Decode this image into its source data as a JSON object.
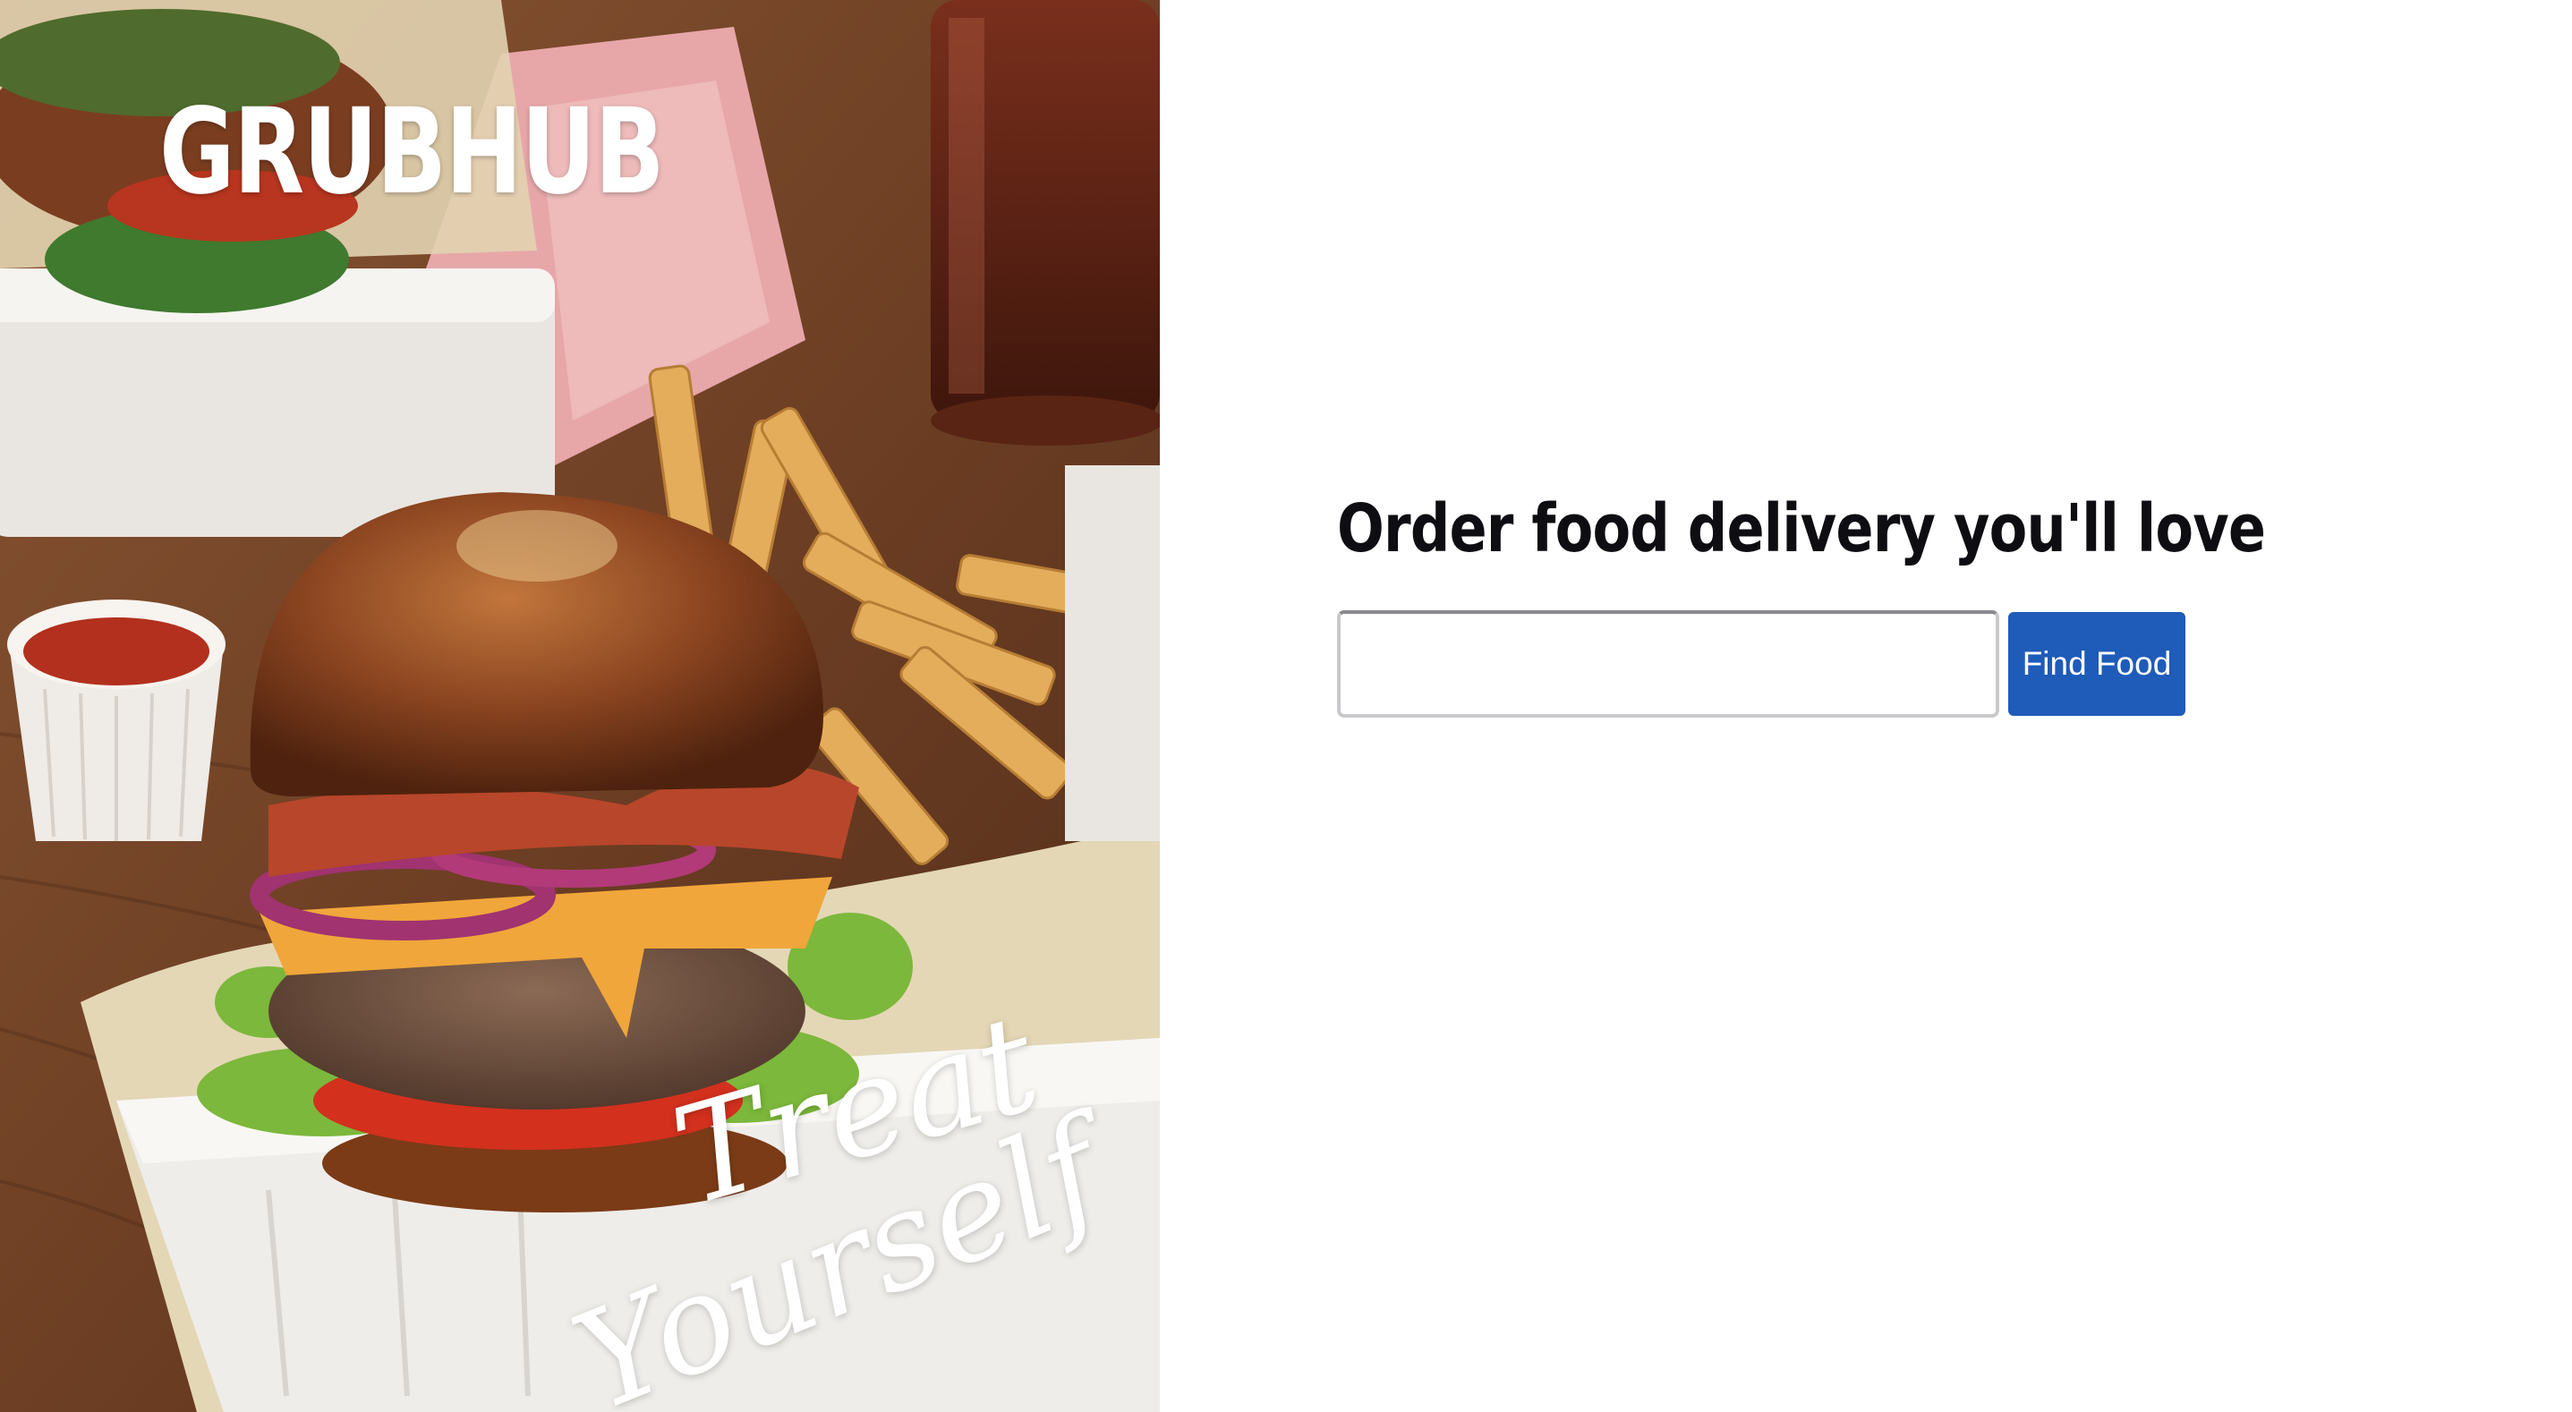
{
  "brand": {
    "logo_text": "GRUBHUB"
  },
  "hero": {
    "tagline_line1": "Treat",
    "tagline_line2": "Yourself",
    "image_subject": "burger-and-fries-photo"
  },
  "main": {
    "headline": "Order food delivery you'll love",
    "search": {
      "value": "",
      "placeholder": ""
    },
    "find_button_label": "Find Food"
  },
  "colors": {
    "button_bg": "#1f5bb8",
    "headline": "#0e0e12",
    "background": "#ffffff"
  }
}
